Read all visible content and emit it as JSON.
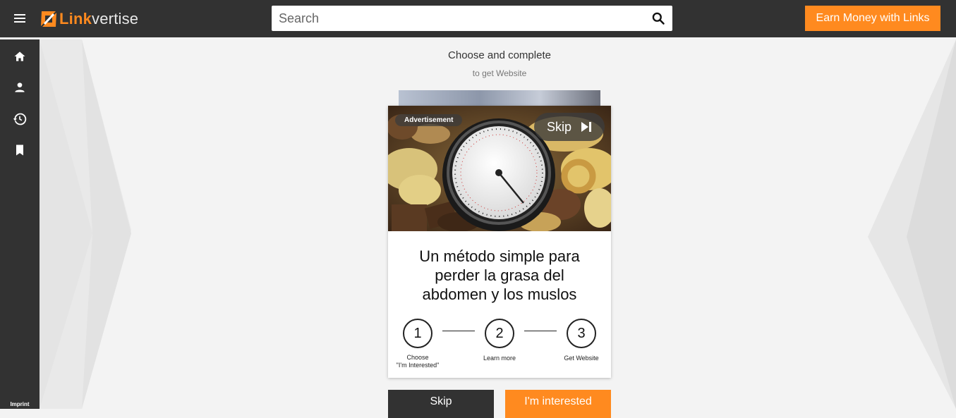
{
  "header": {
    "logo_primary": "Link",
    "logo_secondary": "vertise",
    "search_placeholder": "Search",
    "earn_button": "Earn Money with Links"
  },
  "sidebar": {
    "items": [
      {
        "icon": "home-icon"
      },
      {
        "icon": "account-icon"
      },
      {
        "icon": "history-icon"
      },
      {
        "icon": "bookmark-icon"
      }
    ],
    "imprint": "Imprint"
  },
  "main": {
    "title": "Choose and complete",
    "subtitle": "to get Website",
    "ad": {
      "badge": "Advertisement",
      "skip_label": "Skip",
      "headline": "Un método simple para perder la grasa del abdomen y los muslos"
    },
    "steps": [
      {
        "number": "1",
        "label_line1": "Choose",
        "label_line2": "\"I'm Interested\""
      },
      {
        "number": "2",
        "label_line1": "Learn more",
        "label_line2": ""
      },
      {
        "number": "3",
        "label_line1": "Get Website",
        "label_line2": ""
      }
    ],
    "skip_button": "Skip",
    "interested_button": "I'm interested"
  },
  "colors": {
    "accent": "#ff8a1f",
    "dark": "#323232",
    "background": "#f3f3f3"
  }
}
